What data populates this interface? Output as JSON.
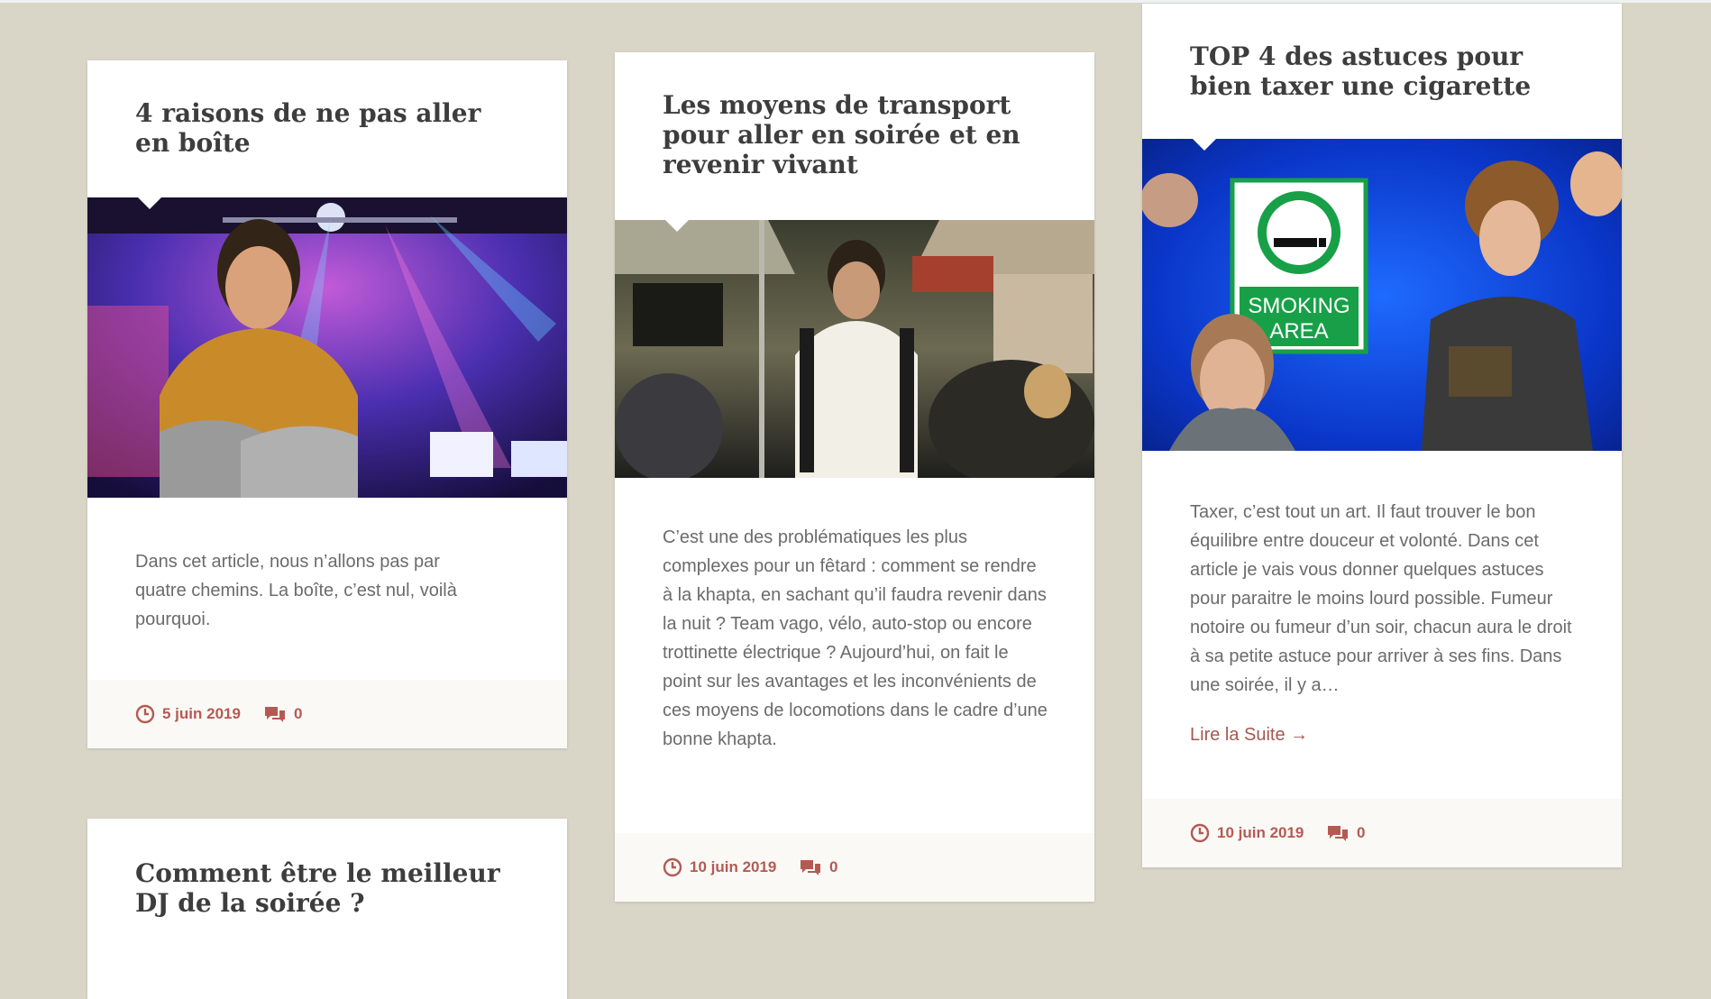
{
  "colors": {
    "background": "#d9d6c8",
    "card": "#ffffff",
    "title": "#3d3d3d",
    "text": "#6b6b6b",
    "accent": "#b55a52"
  },
  "posts": [
    {
      "title": "4 raisons de ne pas aller\nen boîte",
      "image": "photo of a grumpy young man with arms crossed in a crowded nightclub",
      "excerpt": "Dans cet article, nous n’allons pas par quatre chemins. La boîte, c’est nul, voilà pourquoi.",
      "date": "5 juin 2019",
      "comments": "0",
      "date_icon": "clock-icon",
      "comments_icon": "comments-icon"
    },
    {
      "title": "Les moyens de transport pour aller en soirée et en revenir vivant",
      "image": "photo of a young man with a backpack standing in a subway car",
      "excerpt": "C’est une des problématiques les plus complexes pour un fêtard : comment se rendre à la khapta, en sachant qu’il faudra revenir dans la nuit ? Team vago, vélo, auto-stop ou encore trottinette électrique ? Aujourd’hui, on fait le point sur les avantages et les inconvénients de ces moyens de locomotions dans le cadre d’une bonne khapta.",
      "date": "10 juin 2019",
      "comments": "0",
      "date_icon": "clock-icon",
      "comments_icon": "comments-icon"
    },
    {
      "title": "TOP 4 des astuces pour bien taxer une cigarette",
      "image": "collage with a smoking area sign, a man smoking and a curly-haired young man",
      "sign_text_1": "SMOKING",
      "sign_text_2": "AREA",
      "excerpt": "Taxer, c’est tout un art. Il faut trouver le bon équilibre entre douceur et volonté. Dans cet article je vais vous donner quelques astuces pour paraitre le moins lourd possible. Fumeur notoire ou fumeur d’un soir, chacun aura le droit à sa petite astuce pour arriver à ses fins. Dans une soirée, il y a…",
      "read_more": "Lire la Suite →",
      "date": "10 juin 2019",
      "comments": "0",
      "date_icon": "clock-icon",
      "comments_icon": "comments-icon"
    },
    {
      "title": "Comment être le meilleur DJ de la soirée ?"
    }
  ]
}
